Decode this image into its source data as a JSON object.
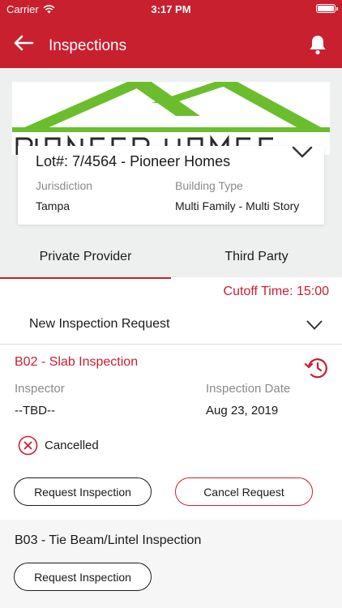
{
  "status_bar": {
    "carrier": "Carrier",
    "time": "3:17 PM"
  },
  "nav": {
    "title": "Inspections",
    "back_icon": "back-arrow-icon",
    "bell_icon": "bell-icon"
  },
  "logo": {
    "alt": "Pioneer Homes logo"
  },
  "property": {
    "lot": "Lot#: 7/4564 - Pioneer Homes",
    "jurisdiction_label": "Jurisdiction",
    "jurisdiction_value": "Tampa",
    "building_type_label": "Building Type",
    "building_type_value": "Multi Family - Multi Story"
  },
  "tabs": [
    {
      "label": "Private Provider",
      "active": true
    },
    {
      "label": "Third Party",
      "active": false
    }
  ],
  "cutoff": "Cutoff Time: 15:00",
  "new_request": {
    "label": "New Inspection Request"
  },
  "inspections": [
    {
      "title": "B02 - Slab Inspection",
      "inspector_label": "Inspector",
      "inspector_value": "--TBD--",
      "date_label": "Inspection Date",
      "date_value": "Aug 23, 2019",
      "status": "Cancelled",
      "request_button": "Request Inspection",
      "cancel_button": "Cancel Request"
    },
    {
      "title": "B03 - Tie Beam/Lintel Inspection",
      "request_button": "Request Inspection"
    }
  ],
  "colors": {
    "brand_red": "#c8202f",
    "logo_green": "#6cbd2e"
  }
}
